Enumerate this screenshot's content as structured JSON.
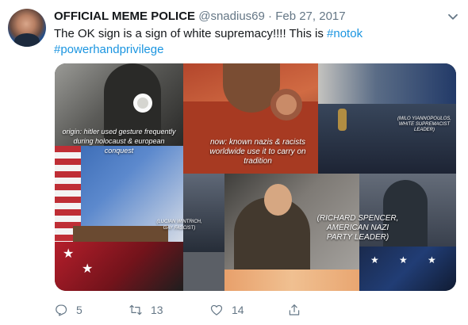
{
  "tweet": {
    "display_name": "OFFICIAL MEME POLICE",
    "handle": "@snadius69",
    "separator": "·",
    "date": "Feb 27, 2017",
    "text_plain": "The OK sign is a sign of white supremacy!!!! This is ",
    "hashtag_1": "#notok",
    "hashtag_2": "#powerhandprivilege"
  },
  "media": {
    "captions": {
      "origin": "origin: hitler used gesture frequently during holocaust & european conquest",
      "known": "now: known nazis & racists worldwide use it to carry on tradition",
      "milo": "(MILO YIANNOPOULOS, WHITE SUPREMACIST LEADER)",
      "lucian": "(LUCIAN WINTRICH, GAY FASCIST)",
      "spencer": "(RICHARD SPENCER, AMERICAN NAZI PARTY LEADER)"
    }
  },
  "actions": {
    "reply_count": "5",
    "retweet_count": "13",
    "like_count": "14"
  },
  "icons": {
    "more": "chevron-down-icon",
    "reply": "reply-icon",
    "retweet": "retweet-icon",
    "like": "heart-icon",
    "share": "share-icon"
  },
  "colors": {
    "link": "#1b95e0",
    "text": "#14171a",
    "muted": "#657786"
  }
}
